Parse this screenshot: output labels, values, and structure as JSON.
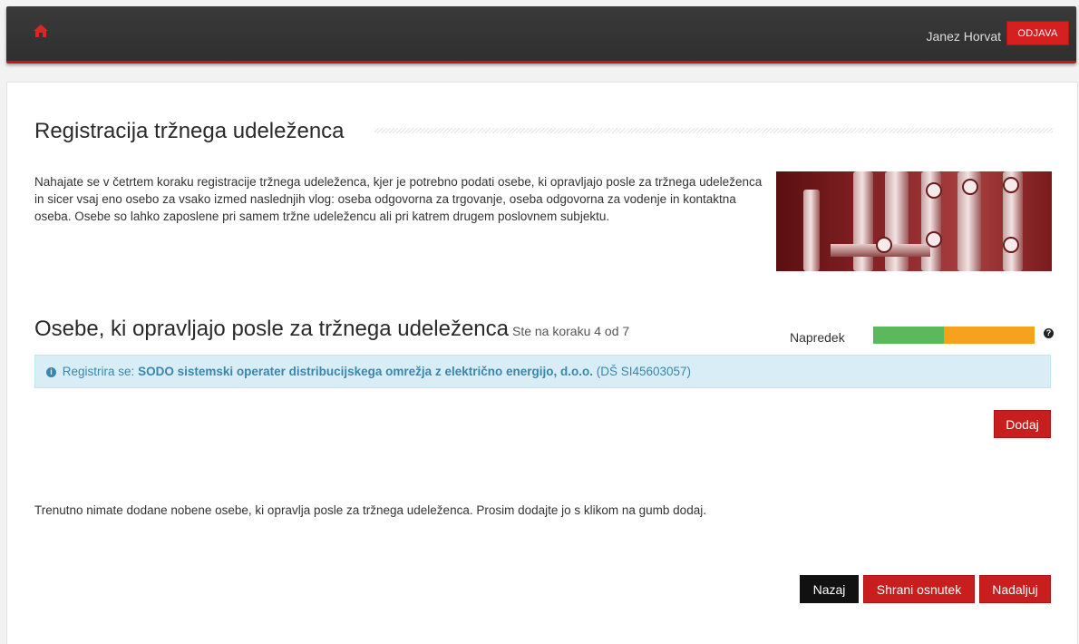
{
  "header": {
    "user_name": "Janez Horvat",
    "logout_label": "ODJAVA",
    "accent_color": "#d6201f",
    "home_icon": "home-icon"
  },
  "main": {
    "title": "Registracija tržnega udeleženca",
    "intro": "Nahajate se v četrtem koraku registracije tržnega udeleženca, kjer je potrebno podati osebe, ki opravljajo posle za tržnega udeleženca in sicer vsaj eno osebo za vsako izmed naslednjih vlog: oseba odgovorna za trgovanje, oseba odgovorna za vodenje in kontaktna oseba. Osebe so lahko zaposlene pri samem tržne udeležencu ali pri katrem drugem poslovnem subjektu.",
    "section_title": "Osebe, ki opravljajo posle za tržnega udeleženca",
    "step_text": "Ste na koraku 4 od 7",
    "progress": {
      "label": "Napredek",
      "fraction": 0.44,
      "done_color": "#5cb85c",
      "remaining_color": "#f6a21f"
    },
    "info": {
      "prefix": "Registrira se:",
      "entity": "SODO sistemski operater distribucijskega omrežja z električno energijo, d.o.o.",
      "tax_id": "(DŠ SI45603057)"
    },
    "add_label": "Dodaj",
    "empty_message": "Trenutno nimate dodane nobene osebe, ki opravlja posle za tržnega udeleženca. Prosim dodajte jo s klikom na gumb dodaj.",
    "actions": {
      "back_label": "Nazaj",
      "save_draft_label": "Shrani osnutek",
      "continue_label": "Nadaljuj"
    }
  }
}
